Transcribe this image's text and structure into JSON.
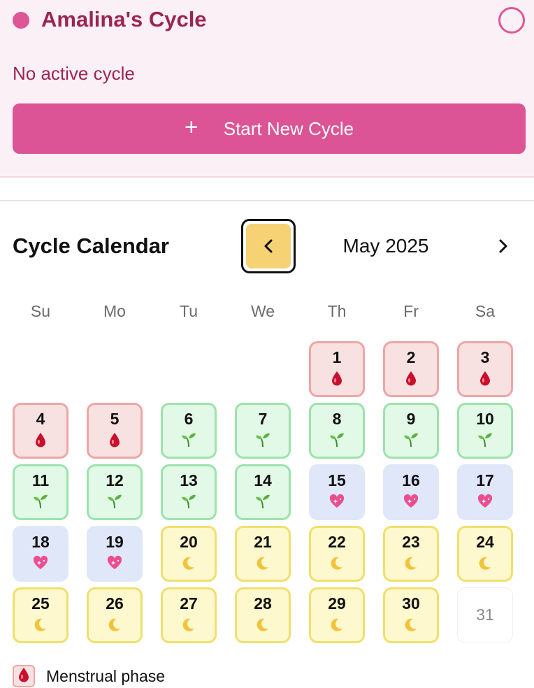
{
  "header": {
    "title": "Amalina's Cycle",
    "status_text": "No active cycle",
    "start_button_label": "Start New Cycle",
    "accent_color": "#de5695"
  },
  "calendar": {
    "title": "Cycle Calendar",
    "month_label": "May 2025",
    "weekdays": [
      "Su",
      "Mo",
      "Tu",
      "We",
      "Th",
      "Fr",
      "Sa"
    ],
    "leading_blank_days": 4,
    "days": [
      {
        "day": "1",
        "phase": "menstrual",
        "icon": "blood-drop-icon"
      },
      {
        "day": "2",
        "phase": "menstrual",
        "icon": "blood-drop-icon"
      },
      {
        "day": "3",
        "phase": "menstrual",
        "icon": "blood-drop-icon"
      },
      {
        "day": "4",
        "phase": "menstrual",
        "icon": "blood-drop-icon"
      },
      {
        "day": "5",
        "phase": "menstrual",
        "icon": "blood-drop-icon"
      },
      {
        "day": "6",
        "phase": "follicular",
        "icon": "seedling-icon"
      },
      {
        "day": "7",
        "phase": "follicular",
        "icon": "seedling-icon"
      },
      {
        "day": "8",
        "phase": "follicular",
        "icon": "seedling-icon"
      },
      {
        "day": "9",
        "phase": "follicular",
        "icon": "seedling-icon"
      },
      {
        "day": "10",
        "phase": "follicular",
        "icon": "seedling-icon"
      },
      {
        "day": "11",
        "phase": "follicular",
        "icon": "seedling-icon"
      },
      {
        "day": "12",
        "phase": "follicular",
        "icon": "seedling-icon"
      },
      {
        "day": "13",
        "phase": "follicular",
        "icon": "seedling-icon"
      },
      {
        "day": "14",
        "phase": "follicular",
        "icon": "seedling-icon"
      },
      {
        "day": "15",
        "phase": "ovulation",
        "icon": "sparkling-heart-icon"
      },
      {
        "day": "16",
        "phase": "ovulation",
        "icon": "sparkling-heart-icon"
      },
      {
        "day": "17",
        "phase": "ovulation",
        "icon": "sparkling-heart-icon"
      },
      {
        "day": "18",
        "phase": "ovulation",
        "icon": "sparkling-heart-icon"
      },
      {
        "day": "19",
        "phase": "ovulation",
        "icon": "sparkling-heart-icon"
      },
      {
        "day": "20",
        "phase": "luteal",
        "icon": "crescent-moon-icon"
      },
      {
        "day": "21",
        "phase": "luteal",
        "icon": "crescent-moon-icon"
      },
      {
        "day": "22",
        "phase": "luteal",
        "icon": "crescent-moon-icon"
      },
      {
        "day": "23",
        "phase": "luteal",
        "icon": "crescent-moon-icon"
      },
      {
        "day": "24",
        "phase": "luteal",
        "icon": "crescent-moon-icon"
      },
      {
        "day": "25",
        "phase": "luteal",
        "icon": "crescent-moon-icon"
      },
      {
        "day": "26",
        "phase": "luteal",
        "icon": "crescent-moon-icon"
      },
      {
        "day": "27",
        "phase": "luteal",
        "icon": "crescent-moon-icon"
      },
      {
        "day": "28",
        "phase": "luteal",
        "icon": "crescent-moon-icon"
      },
      {
        "day": "29",
        "phase": "luteal",
        "icon": "crescent-moon-icon"
      },
      {
        "day": "30",
        "phase": "luteal",
        "icon": "crescent-moon-icon"
      },
      {
        "day": "31",
        "phase": "none",
        "icon": ""
      }
    ],
    "phase_colors": {
      "menstrual": "#f8e1e1",
      "follicular": "#e3f9e7",
      "ovulation": "#dfe7f8",
      "luteal": "#fdf8cd"
    }
  },
  "legend": {
    "items": [
      {
        "label": "Menstrual phase",
        "icon": "blood-drop-icon"
      }
    ]
  }
}
